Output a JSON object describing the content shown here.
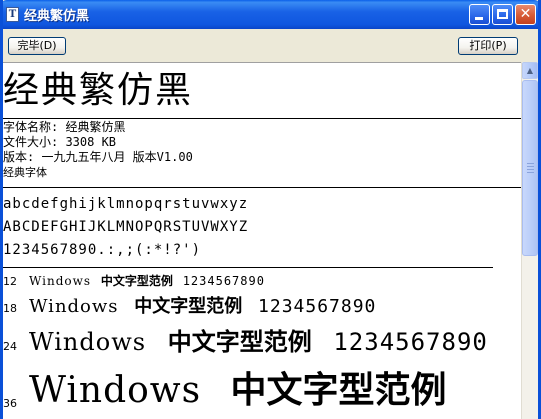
{
  "window": {
    "title": "经典繁仿黑",
    "title_icon": "font-file-icon",
    "caption_buttons": [
      "minimize",
      "maximize",
      "close"
    ]
  },
  "toolbar": {
    "done_label": "完毕(D)",
    "print_label": "打印(P)"
  },
  "preview": {
    "font_display_name": "经典繁仿黑",
    "info_lines": [
      "字体名称: 经典繁仿黑",
      "文件大小: 3308 KB",
      "版本: 一九九五年八月 版本V1.00"
    ],
    "type_line": "经典字体",
    "charset_lines": [
      "abcdefghijklmnopqrstuvwxyz",
      "ABCDEFGHIJKLMNOPQRSTUVWXYZ",
      "1234567890.:,;(:*!?')"
    ],
    "samples": [
      {
        "size_label": "12",
        "latin": "Windows",
        "cjk": "中文字型范例",
        "digits": "1234567890"
      },
      {
        "size_label": "18",
        "latin": "Windows",
        "cjk": "中文字型范例",
        "digits": "1234567890"
      },
      {
        "size_label": "24",
        "latin": "Windows",
        "cjk": "中文字型范例",
        "digits": "1234567890"
      },
      {
        "size_label": "36",
        "latin": "Windows",
        "cjk": "中文字型范例",
        "digits": ""
      }
    ]
  },
  "colors": {
    "titlebar": "#0a5fe9",
    "window_face": "#ece9d8",
    "preview_bg": "#ffffff"
  }
}
